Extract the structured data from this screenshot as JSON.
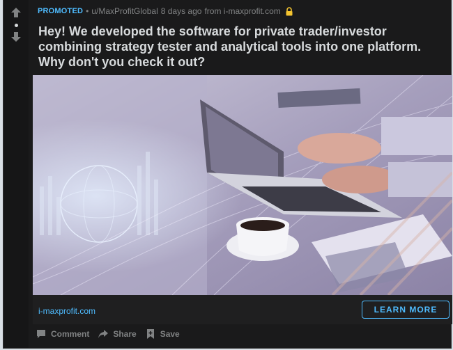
{
  "post": {
    "promoted_label": "PROMOTED",
    "separator": "•",
    "author": "u/MaxProfitGlobal",
    "age": "8 days ago",
    "from_label": "from i-maxprofit.com",
    "title": "Hey! We developed the software for private trader/investor combining strategy tester and analytical tools into one platform. Why don't you check it out?"
  },
  "link": {
    "url": "i-maxprofit.com",
    "cta": "LEARN MORE"
  },
  "actions": {
    "comment": "Comment",
    "share": "Share",
    "save": "Save"
  },
  "colors": {
    "accent": "#4fbcff",
    "card_bg": "#1a1a1b",
    "text": "#d7dadc",
    "muted": "#818384",
    "lock": "#f4c430"
  },
  "icons": {
    "upvote": "arrow-up-icon",
    "downvote": "arrow-down-icon",
    "lock": "lock-icon",
    "comment": "comment-icon",
    "share": "share-icon",
    "save": "bookmark-icon"
  }
}
